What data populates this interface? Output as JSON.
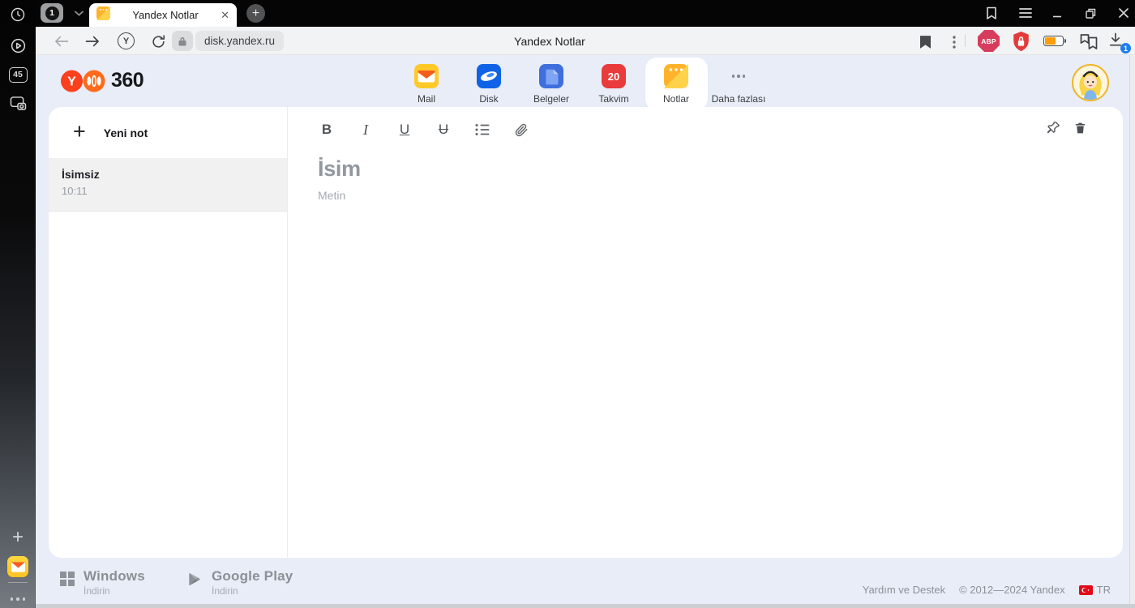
{
  "browser": {
    "tab_counter": "1",
    "tab_title": "Yandex Notlar",
    "new_tab": "+",
    "page_title": "Yandex Notlar",
    "url": "disk.yandex.ru",
    "abp_label": "ABP",
    "download_badge": "1",
    "sidebar_badge": "45",
    "protect_letter": "Y"
  },
  "header": {
    "logo_letter": "Y",
    "logo_text": "360",
    "services": [
      {
        "label": "Mail"
      },
      {
        "label": "Disk"
      },
      {
        "label": "Belgeler"
      },
      {
        "label": "Takvim",
        "badge": "20"
      },
      {
        "label": "Notlar"
      },
      {
        "label": "Daha fazlası"
      }
    ]
  },
  "notes_panel": {
    "new_note_label": "Yeni not",
    "new_note_plus": "+",
    "notes": [
      {
        "title": "İsimsiz",
        "time": "10:11"
      }
    ]
  },
  "editor": {
    "title_placeholder": "İsim",
    "body_placeholder": "Metin",
    "toolbar": {
      "bold": "B",
      "italic": "I",
      "underline": "U",
      "strikethrough": "U"
    }
  },
  "footer": {
    "windows": {
      "name": "Windows",
      "sub": "İndirin"
    },
    "gplay": {
      "name": "Google Play",
      "sub": "İndirin"
    },
    "help": "Yardım ve Destek",
    "copyright": "© 2012—2024 Yandex",
    "lang": "TR"
  },
  "colors": {
    "accent_red": "#fc3f1d",
    "header_bg": "#e8edf8",
    "notes_orange": "#ffb32b",
    "calendar_red": "#e93b3b",
    "badge_blue": "#1e7df0"
  }
}
